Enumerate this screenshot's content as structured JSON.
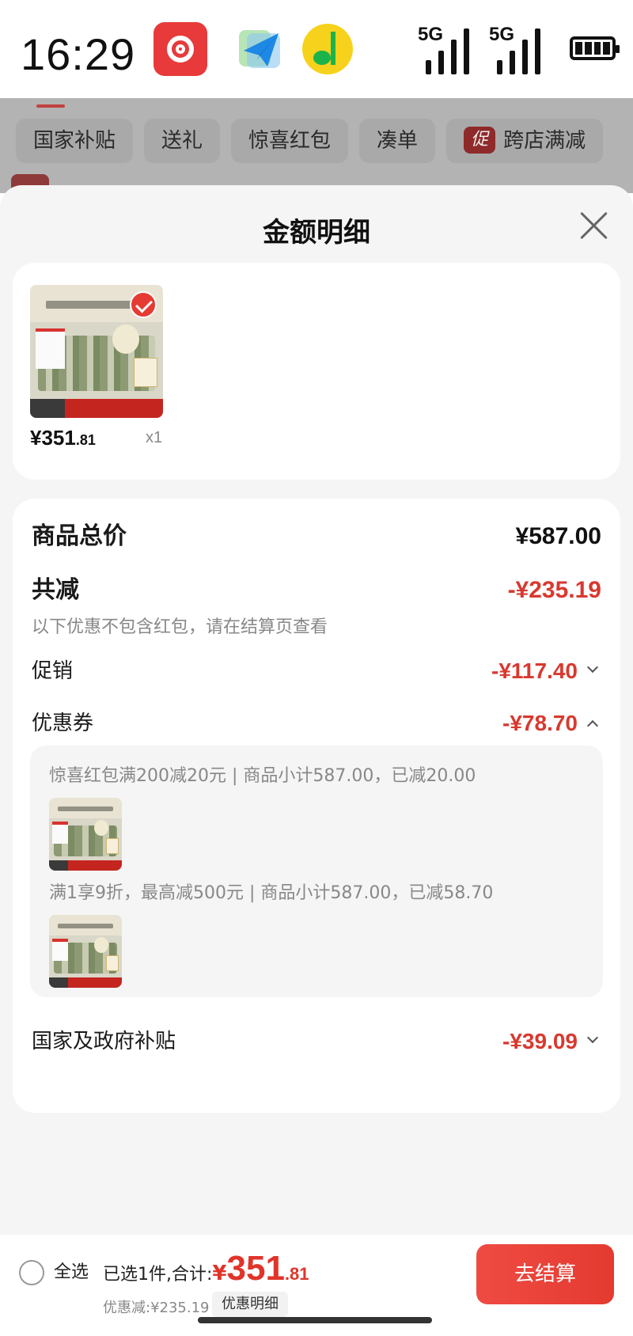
{
  "status_bar": {
    "time": "16:29",
    "apps": [
      "netease-music-icon",
      "send-arrow-icon",
      "qq-music-icon"
    ],
    "signal_1": "5G",
    "signal_2": "5G",
    "battery_icon": "battery-icon"
  },
  "background_page": {
    "tabs": [
      "国家补贴",
      "送礼",
      "惊喜红包",
      "凑单",
      "跨店满减"
    ],
    "promo_badge": "促"
  },
  "sheet": {
    "title": "金额明细",
    "close_icon": "close-icon"
  },
  "product": {
    "price_int": "¥351",
    "price_dec": ".81",
    "quantity": "x1",
    "selected": true
  },
  "price_breakdown": {
    "total_label": "商品总价",
    "total_value": "¥587.00",
    "reduce_label": "共减",
    "reduce_value": "-¥235.19",
    "reduce_note": "以下优惠不包含红包，请在结算页查看",
    "promo_label": "促销",
    "promo_value": "-¥117.40",
    "coupon_label": "优惠券",
    "coupon_value": "-¥78.70",
    "coupons": [
      {
        "text": "惊喜红包满200减20元 | 商品小计587.00，已减20.00"
      },
      {
        "text": "满1享9折，最高减500元 | 商品小计587.00，已减58.70"
      }
    ],
    "subsidy_label": "国家及政府补贴",
    "subsidy_value": "-¥39.09"
  },
  "bottom_bar": {
    "select_all": "全选",
    "sum_label": "已选1件,合计:",
    "sum_currency": "¥",
    "sum_int": "351",
    "sum_dec": ".81",
    "discount_text": "优惠减:¥235.19",
    "detail_chip": "优惠明细",
    "checkout": "去结算"
  },
  "colors": {
    "accent_red": "#e0342a",
    "discount_red": "#d8392f",
    "sheet_bg": "#f5f5f5"
  }
}
